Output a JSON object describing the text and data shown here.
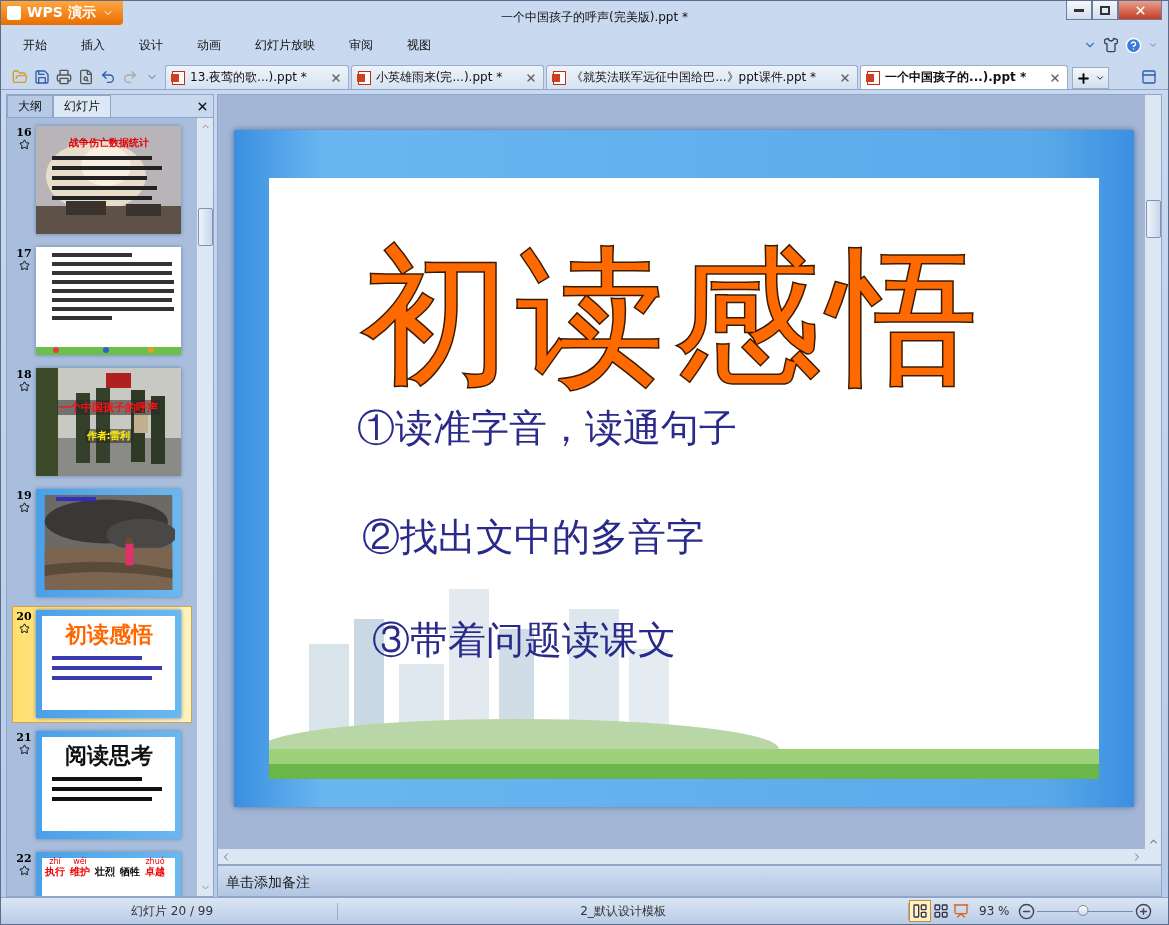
{
  "app_button": {
    "label": "WPS 演示"
  },
  "window": {
    "title": "一个中国孩子的呼声(完美版).ppt *"
  },
  "menu": [
    {
      "label": "开始"
    },
    {
      "label": "插入"
    },
    {
      "label": "设计"
    },
    {
      "label": "动画"
    },
    {
      "label": "幻灯片放映"
    },
    {
      "label": "审阅"
    },
    {
      "label": "视图"
    }
  ],
  "doc_tabs": [
    {
      "label": "13.夜莺的歌...).ppt *",
      "selected": false
    },
    {
      "label": "小英雄雨来(完...).ppt *",
      "selected": false
    },
    {
      "label": "《就英法联军远征中国给巴...》ppt课件.ppt *",
      "selected": false
    },
    {
      "label": "一个中国孩子的...).ppt *",
      "selected": true
    }
  ],
  "panel": {
    "tabs": [
      {
        "label": "大纲",
        "selected": false
      },
      {
        "label": "幻灯片",
        "selected": true
      }
    ]
  },
  "thumbnails": [
    {
      "number": "16",
      "kind": "smoke",
      "selected": false,
      "title": "战争伤亡数据统计"
    },
    {
      "number": "17",
      "kind": "paper",
      "selected": false
    },
    {
      "number": "18",
      "kind": "ceremony",
      "selected": false,
      "title": "一个中国孩子的呼声",
      "subtitle": "作者:雷利"
    },
    {
      "number": "19",
      "kind": "ruins",
      "selected": false
    },
    {
      "number": "20",
      "kind": "template",
      "selected": true,
      "title": "初读感悟",
      "color": "#ff6600"
    },
    {
      "number": "21",
      "kind": "template",
      "selected": false,
      "title": "阅读思考",
      "color": "#111111"
    },
    {
      "number": "22",
      "kind": "words",
      "selected": false,
      "words": [
        {
          "pinyin": "zhí",
          "text": "执行"
        },
        {
          "pinyin": "wéi",
          "text": "维护"
        },
        {
          "text": "壮烈"
        },
        {
          "text": "牺牲"
        },
        {
          "pinyin": "zhuó",
          "text": "卓越"
        }
      ]
    }
  ],
  "slide": {
    "title": "初读感悟",
    "lines": [
      "①读准字音，读通句子",
      "②找出文中的多音字",
      "③带着问题读课文"
    ]
  },
  "notes": {
    "placeholder": "单击添加备注"
  },
  "status_bar": {
    "slide_count": "幻灯片 20 / 99",
    "template": "2_默认设计模板",
    "views": [
      {
        "kind": "normal",
        "selected": true
      },
      {
        "kind": "sorter",
        "selected": false
      },
      {
        "kind": "show",
        "selected": false
      }
    ],
    "zoom": "93 %",
    "level": 0.48
  }
}
